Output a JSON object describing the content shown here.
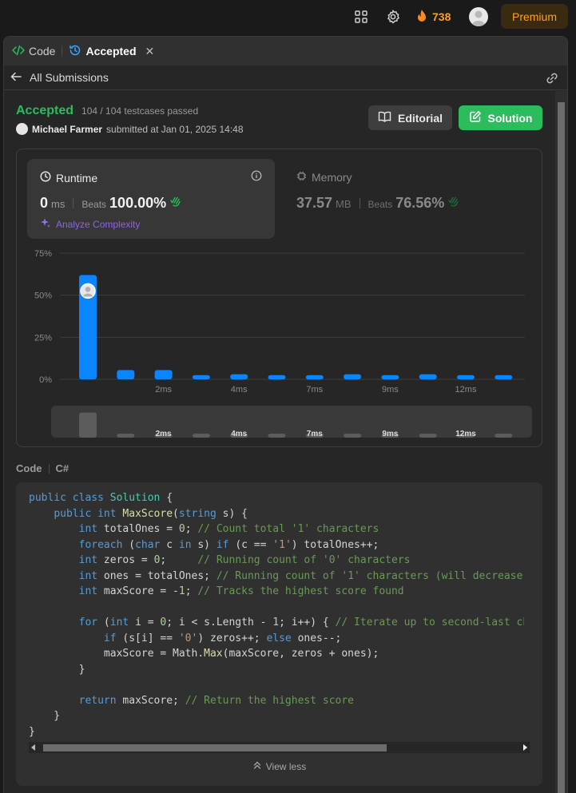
{
  "topnav": {
    "streak_count": "738",
    "premium_label": "Premium"
  },
  "tabs": {
    "code_label": "Code",
    "accepted_label": "Accepted"
  },
  "subbar": {
    "back_label": "All Submissions"
  },
  "result": {
    "status": "Accepted",
    "testcases": "104 / 104 testcases passed",
    "username": "Michael Farmer",
    "submitted_text": "submitted at Jan 01, 2025 14:48"
  },
  "buttons": {
    "editorial": "Editorial",
    "solution": "Solution"
  },
  "runtime": {
    "title": "Runtime",
    "value": "0",
    "unit": "ms",
    "beats_label": "Beats",
    "beats_value": "100.00%",
    "analyze_label": "Analyze Complexity"
  },
  "memory": {
    "title": "Memory",
    "value": "37.57",
    "unit": "MB",
    "beats_label": "Beats",
    "beats_value": "76.56%"
  },
  "chart_data": {
    "type": "bar",
    "title": "",
    "xlabel": "",
    "ylabel": "",
    "y_ticks": [
      "75%",
      "50%",
      "25%",
      "0%"
    ],
    "ylim": [
      0,
      75
    ],
    "x_tick_labels": [
      "",
      "",
      "2ms",
      "",
      "4ms",
      "",
      "7ms",
      "",
      "9ms",
      "",
      "12ms",
      ""
    ],
    "values": [
      62,
      5.5,
      5.5,
      2.5,
      3,
      2.5,
      2.5,
      3,
      2.5,
      3,
      2.5,
      2.5
    ],
    "highlight_index": 0,
    "grid": true,
    "colors": {
      "bar": "#0a84ff",
      "grid": "#3d3d3d",
      "axis_text": "#8a8a8a"
    }
  },
  "code_section": {
    "label": "Code",
    "language": "C#",
    "view_less": "View less"
  }
}
